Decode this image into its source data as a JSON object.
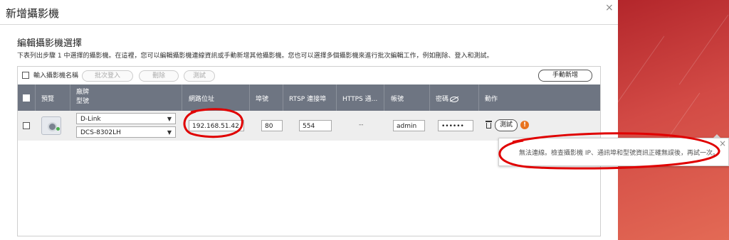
{
  "dialog": {
    "title": "新增攝影機",
    "close": "×",
    "section_title": "編輯攝影機選擇",
    "section_desc": "下表列出步驟 1 中選擇的攝影機。在這裡，您可以編輯攝影機連線資訊或手動新增其他攝影機。您也可以選擇多個攝影機來進行批次編輯工作，例如刪除、登入和測試。"
  },
  "toolbar": {
    "checkbox_label": "輸入攝影機名稱",
    "batch_login": "批次登入",
    "delete": "刪除",
    "test": "測試",
    "manual_add": "手動新增"
  },
  "table": {
    "headers": {
      "preview": "預覽",
      "brand": "廠牌",
      "model": "型號",
      "ip": "網路位址",
      "port": "埠號",
      "rtsp": "RTSP 連接埠",
      "https": "HTTPS 通...",
      "account": "帳號",
      "password": "密碼",
      "action": "動作"
    },
    "row": {
      "brand": "D-Link",
      "model": "DCS-8302LH",
      "ip": "192.168.51.42",
      "port": "80",
      "rtsp": "554",
      "https": "--",
      "account": "admin",
      "password": "••••••",
      "test": "測試",
      "warn": "!"
    }
  },
  "tooltip": {
    "text": "無法連線。檢查攝影機 IP、通訊埠和型號資訊正確無誤後，再試一次。",
    "close": "×"
  },
  "colors": {
    "header_bg": "#6e7582",
    "warning": "#e8731f",
    "annotation": "#e00000"
  }
}
